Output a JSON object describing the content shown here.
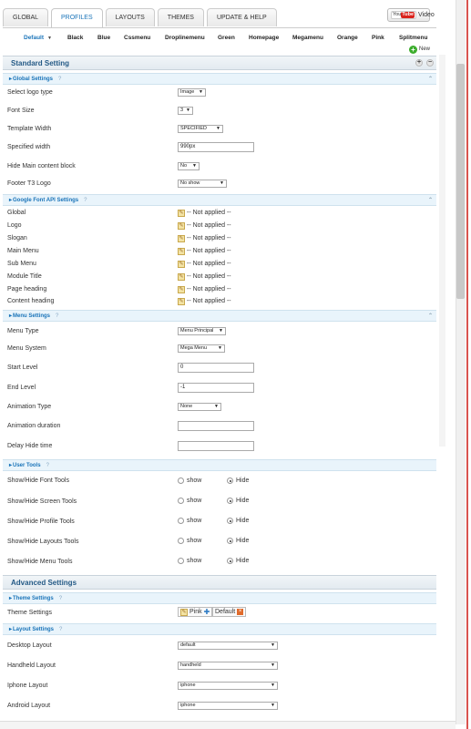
{
  "tabs": [
    "GLOBAL",
    "PROFILES",
    "LAYOUTS",
    "THEMES",
    "UPDATE & HELP"
  ],
  "youtube": {
    "logo_you": "You",
    "logo_tube": "Tube",
    "label": "Video"
  },
  "profiles": {
    "items": [
      "Default",
      "Black",
      "Blue",
      "Cssmenu",
      "Droplinemenu",
      "Green",
      "Homepage",
      "Megamenu",
      "Orange",
      "Pink",
      "Splitmenu"
    ],
    "new_label": "New"
  },
  "standard": {
    "title": "Standard Setting"
  },
  "global_settings": {
    "title": "Global Settings",
    "help": "?",
    "rows": [
      {
        "label": "Select logo type",
        "value": "Image"
      },
      {
        "label": "Font Size",
        "value": "3"
      },
      {
        "label": "Template Width",
        "value": "SPECIFIED"
      },
      {
        "label": "Specified width",
        "value": "990px"
      },
      {
        "label": "Hide Main content block",
        "value": "No"
      },
      {
        "label": "Footer T3 Logo",
        "value": "No show"
      }
    ]
  },
  "google_font": {
    "title": "Google Font API Settings",
    "help": "?",
    "value": "-- Not applied --",
    "rows": [
      "Global",
      "Logo",
      "Slogan",
      "Main Menu",
      "Sub Menu",
      "Module Title",
      "Page heading",
      "Content heading"
    ]
  },
  "menu_settings": {
    "title": "Menu Settings",
    "help": "?",
    "rows": [
      {
        "label": "Menu Type",
        "value": "Menu Principal"
      },
      {
        "label": "Menu System",
        "value": "Mega Menu"
      },
      {
        "label": "Start Level",
        "value": "0"
      },
      {
        "label": "End Level",
        "value": "-1"
      },
      {
        "label": "Animation Type",
        "value": "None"
      },
      {
        "label": "Animation duration",
        "value": ""
      },
      {
        "label": "Delay Hide time",
        "value": ""
      }
    ]
  },
  "user_tools": {
    "title": "User Tools",
    "help": "?",
    "show_label": "show",
    "hide_label": "Hide",
    "rows": [
      "Show/Hide Font Tools",
      "Show/Hide Screen Tools",
      "Show/Hide Profile Tools",
      "Show/Hide Layouts Tools",
      "Show/Hide Menu Tools"
    ]
  },
  "advanced": {
    "title": "Advanced Settings"
  },
  "theme_settings": {
    "title": "Theme Settings",
    "help": "?",
    "label": "Theme Settings",
    "badge1": "Pink",
    "badge2": "Default"
  },
  "layout_settings": {
    "title": "Layout Settings",
    "help": "?",
    "rows": [
      {
        "label": "Desktop Layout",
        "value": "default"
      },
      {
        "label": "Handheld Layout",
        "value": "handheld"
      },
      {
        "label": "Iphone Layout",
        "value": "iphone"
      },
      {
        "label": "Android Layout",
        "value": "iphone"
      }
    ]
  }
}
